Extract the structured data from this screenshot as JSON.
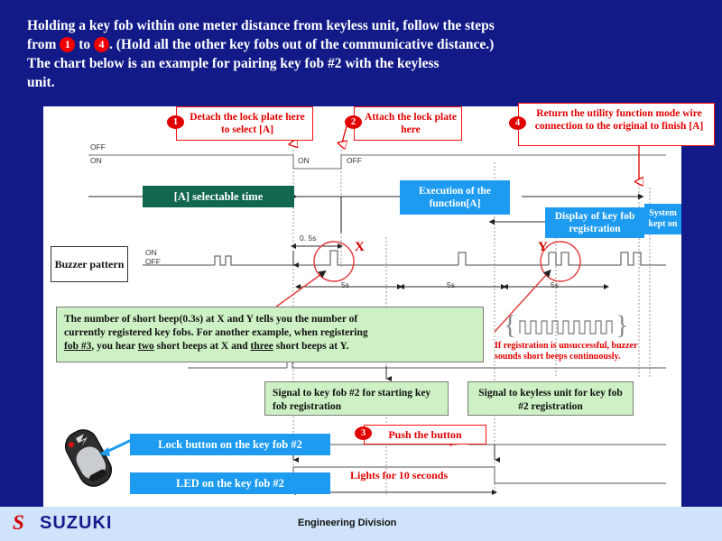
{
  "header": {
    "line1_a": "Holding a key fob within one meter distance from keyless unit, follow the steps",
    "line1_b": "from",
    "badge1": "1",
    "line1_c": "to",
    "badge4": "4",
    "line1_d": ". (Hold all the other key fobs out of the communicative distance.)",
    "line2": "The chart below is an example for pairing key fob #2 with the keyless",
    "line3": "unit."
  },
  "callouts": {
    "step1": {
      "num": "1",
      "text": "Detach the lock plate here to select [A]"
    },
    "step2": {
      "num": "2",
      "text": "Attach the lock plate here"
    },
    "step4": {
      "num": "4",
      "text": "Return the utility function mode wire connection  to the original to finish [A]"
    },
    "step3": {
      "num": "3",
      "text": "Push the button"
    }
  },
  "boxes": {
    "selectable_time": "[A] selectable time",
    "execution": "Execution  of the function[A]",
    "display_registration": "Display of key fob registration",
    "system_kept_on": "System kept on",
    "buzzer_pattern": "Buzzer pattern",
    "signal_to_fob": "Signal to key fob #2 for starting key fob registration",
    "signal_to_unit": "Signal to keyless unit for key fob #2 registration",
    "lock_button": "Lock button on the key fob #2",
    "led": "LED on the key fob #2"
  },
  "note": {
    "line1": "The number of short beep(0.3s) at X and Y tells you the number of",
    "line2": "currently registered key fobs. For another example, when registering",
    "line3_a": "fob #3",
    "line3_b": ", you hear ",
    "line3_c": "two",
    "line3_d": " short beeps at X and ",
    "line3_e": "three",
    "line3_f": " short beeps at Y."
  },
  "warning": {
    "line1": "If registration is unsuccessful, buzzer",
    "line2": "sounds short beeps continuously."
  },
  "annotations": {
    "off_top": "OFF",
    "on_top": "ON",
    "on_mid": "ON",
    "off_mid": "OFF",
    "on_label": "ON",
    "off_label": "OFF",
    "half_second": "0. 5s",
    "five_s_1": "5s",
    "five_s_2": "5s",
    "five_s_3": "5s",
    "mark_x": "X",
    "mark_y": "Y",
    "lights_10s": "Lights for 10 seconds"
  },
  "footer": {
    "logo_mark": "S",
    "brand": "SUZUKI",
    "department": "Engineering Division"
  },
  "colors": {
    "background": "#111a87",
    "accent_red": "#e00000",
    "blue_box": "#1d9bf0",
    "green_box": "#12684f",
    "note_green": "#cdf0c4",
    "footer": "#cfe4fb"
  }
}
